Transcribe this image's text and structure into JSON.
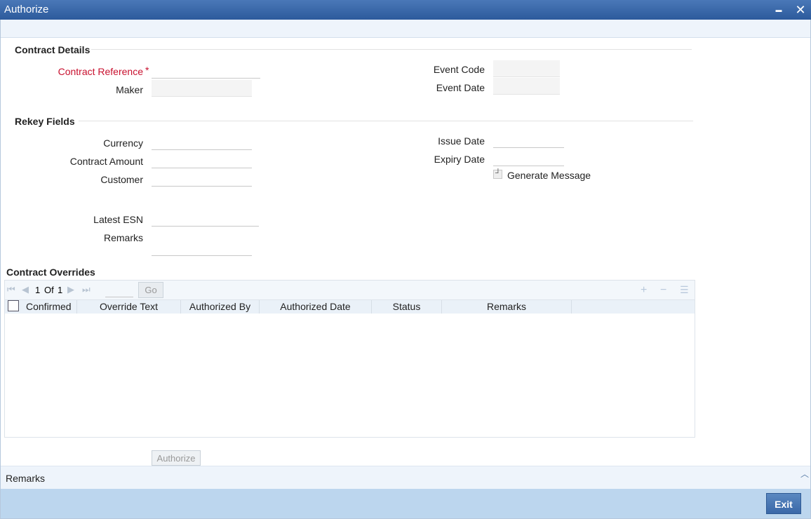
{
  "window": {
    "title": "Authorize",
    "minimize_glyph": "▬",
    "close_glyph": "✕"
  },
  "contract_details": {
    "section_title": "Contract Details",
    "contract_reference": {
      "label": "Contract Reference",
      "required_mark": "*",
      "value": ""
    },
    "maker": {
      "label": "Maker",
      "value": ""
    },
    "event_code": {
      "label": "Event Code",
      "value": ""
    },
    "event_date": {
      "label": "Event Date",
      "value": ""
    }
  },
  "rekey_fields": {
    "section_title": "Rekey Fields",
    "currency": {
      "label": "Currency",
      "value": ""
    },
    "contract_amount": {
      "label": "Contract Amount",
      "value": ""
    },
    "customer": {
      "label": "Customer",
      "value": ""
    },
    "issue_date": {
      "label": "Issue Date",
      "value": ""
    },
    "expiry_date": {
      "label": "Expiry Date",
      "value": ""
    },
    "generate_message": {
      "label": "Generate Message",
      "checked": false
    },
    "latest_esn": {
      "label": "Latest ESN",
      "value": ""
    },
    "remarks": {
      "label": "Remarks",
      "value": ""
    }
  },
  "contract_overrides": {
    "section_title": "Contract Overrides",
    "pagination": {
      "current": "1",
      "of_label": "Of",
      "total": "1",
      "go_label": "Go"
    },
    "columns": [
      "Confirmed",
      "Override Text",
      "Authorized By",
      "Authorized Date",
      "Status",
      "Remarks"
    ],
    "rows": []
  },
  "actions": {
    "authorize_label": "Authorize",
    "exit_label": "Exit"
  },
  "footer": {
    "remarks_label": "Remarks"
  },
  "icons": {
    "first_page": "first-page-icon",
    "prev_page": "prev-page-icon",
    "next_page": "next-page-icon",
    "last_page": "last-page-icon",
    "add_row": "add-row-icon",
    "delete_row": "delete-row-icon",
    "single_view": "single-view-icon",
    "collapse": "chevron-up-icon"
  },
  "colors": {
    "title_bar": "#2c5a9c",
    "required": "#c8102e",
    "footer": "#bcd6ee",
    "exit_button": "#3a68a8"
  }
}
